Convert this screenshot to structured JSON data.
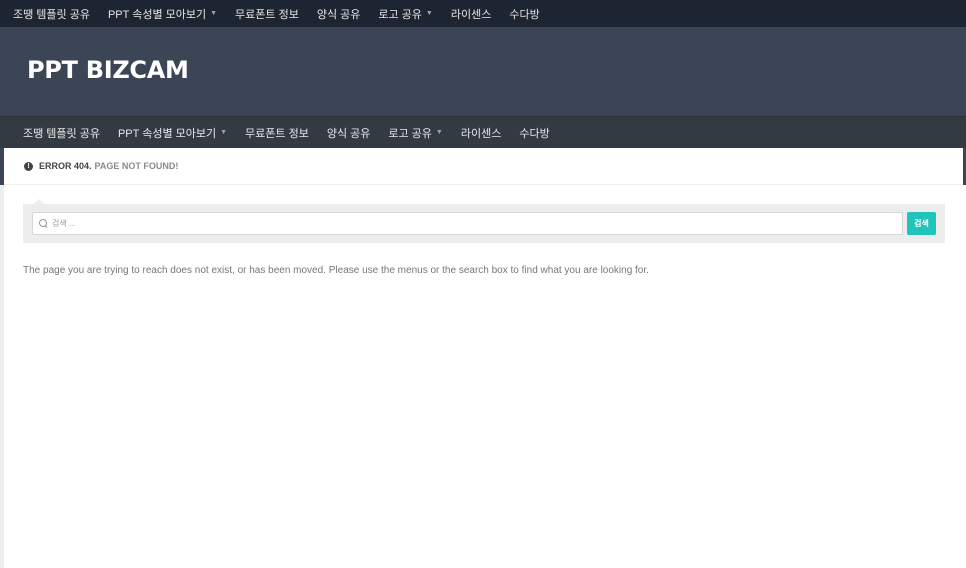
{
  "top_nav": {
    "items": [
      {
        "label": "조땡 템플릿 공유",
        "has_dropdown": false
      },
      {
        "label": "PPT 속성별 모아보기",
        "has_dropdown": true
      },
      {
        "label": "무료폰트 정보",
        "has_dropdown": false
      },
      {
        "label": "양식 공유",
        "has_dropdown": false
      },
      {
        "label": "로고 공유",
        "has_dropdown": true
      },
      {
        "label": "라이센스",
        "has_dropdown": false
      },
      {
        "label": "수다방",
        "has_dropdown": false
      }
    ]
  },
  "header": {
    "site_title": "PPT BIZCAM"
  },
  "main_nav": {
    "items": [
      {
        "label": "조땡 템플릿 공유",
        "has_dropdown": false
      },
      {
        "label": "PPT 속성별 모아보기",
        "has_dropdown": true
      },
      {
        "label": "무료폰트 정보",
        "has_dropdown": false
      },
      {
        "label": "양식 공유",
        "has_dropdown": false
      },
      {
        "label": "로고 공유",
        "has_dropdown": true
      },
      {
        "label": "라이센스",
        "has_dropdown": false
      },
      {
        "label": "수다방",
        "has_dropdown": false
      }
    ]
  },
  "error": {
    "icon": "exclamation-circle-icon",
    "code": "ERROR 404.",
    "text": "PAGE NOT FOUND!"
  },
  "search": {
    "placeholder": "검색 ...",
    "value": "",
    "button_label": "검색"
  },
  "message": "The page you are trying to reach does not exist, or has been moved. Please use the menus or the search box to find what you are looking for.",
  "colors": {
    "topbar": "#1e2532",
    "header": "#3b4555",
    "main_nav": "#343a42",
    "accent": "#22c3b8"
  }
}
